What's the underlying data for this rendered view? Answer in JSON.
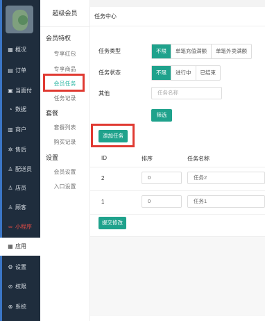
{
  "sidebar": {
    "items": [
      {
        "icon": "grid",
        "label": "概况"
      },
      {
        "icon": "list",
        "label": "订单"
      },
      {
        "icon": "pay",
        "label": "当面付"
      },
      {
        "icon": "chart",
        "label": "数据"
      },
      {
        "icon": "shop",
        "label": "商户"
      },
      {
        "icon": "gear",
        "label": "售后"
      },
      {
        "icon": "user",
        "label": "配送员"
      },
      {
        "icon": "user",
        "label": "店员"
      },
      {
        "icon": "user",
        "label": "顾客"
      },
      {
        "icon": "mini",
        "label": "小程序"
      },
      {
        "icon": "app",
        "label": "应用"
      },
      {
        "icon": "gear",
        "label": "设置"
      },
      {
        "icon": "lock",
        "label": "权限"
      },
      {
        "icon": "sys",
        "label": "系统"
      }
    ]
  },
  "subsidebar": {
    "title": "超级会员",
    "groups": [
      {
        "label": "会员特权",
        "links": [
          "专享红包",
          "专享商品",
          "会员任务",
          "任务记录"
        ]
      },
      {
        "label": "套餐",
        "links": [
          "套餐列表",
          "购买记录"
        ]
      },
      {
        "label": "设置",
        "links": [
          "会员设置",
          "入口设置"
        ]
      }
    ],
    "active_link": "会员任务"
  },
  "main": {
    "header": "任务中心",
    "filters": {
      "task_type_label": "任务类型",
      "task_type_options": [
        "不限",
        "单笔充值满额",
        "单笔外卖满额"
      ],
      "task_status_label": "任务状态",
      "task_status_options": [
        "不限",
        "进行中",
        "已结束"
      ],
      "other_label": "其他",
      "task_name_placeholder": "任务名称",
      "filter_button": "筛选"
    },
    "add_task_button": "添加任务",
    "table": {
      "headers": [
        "ID",
        "排序",
        "任务名称"
      ],
      "rows": [
        {
          "id": "2",
          "sort": "0",
          "name": "任务2"
        },
        {
          "id": "1",
          "sort": "0",
          "name": "任务1"
        }
      ]
    },
    "submit_button": "提交修改"
  },
  "colors": {
    "accent": "#1fa28c",
    "sidebar_bg": "#1f2d3d",
    "highlight_red": "#e03a32"
  }
}
